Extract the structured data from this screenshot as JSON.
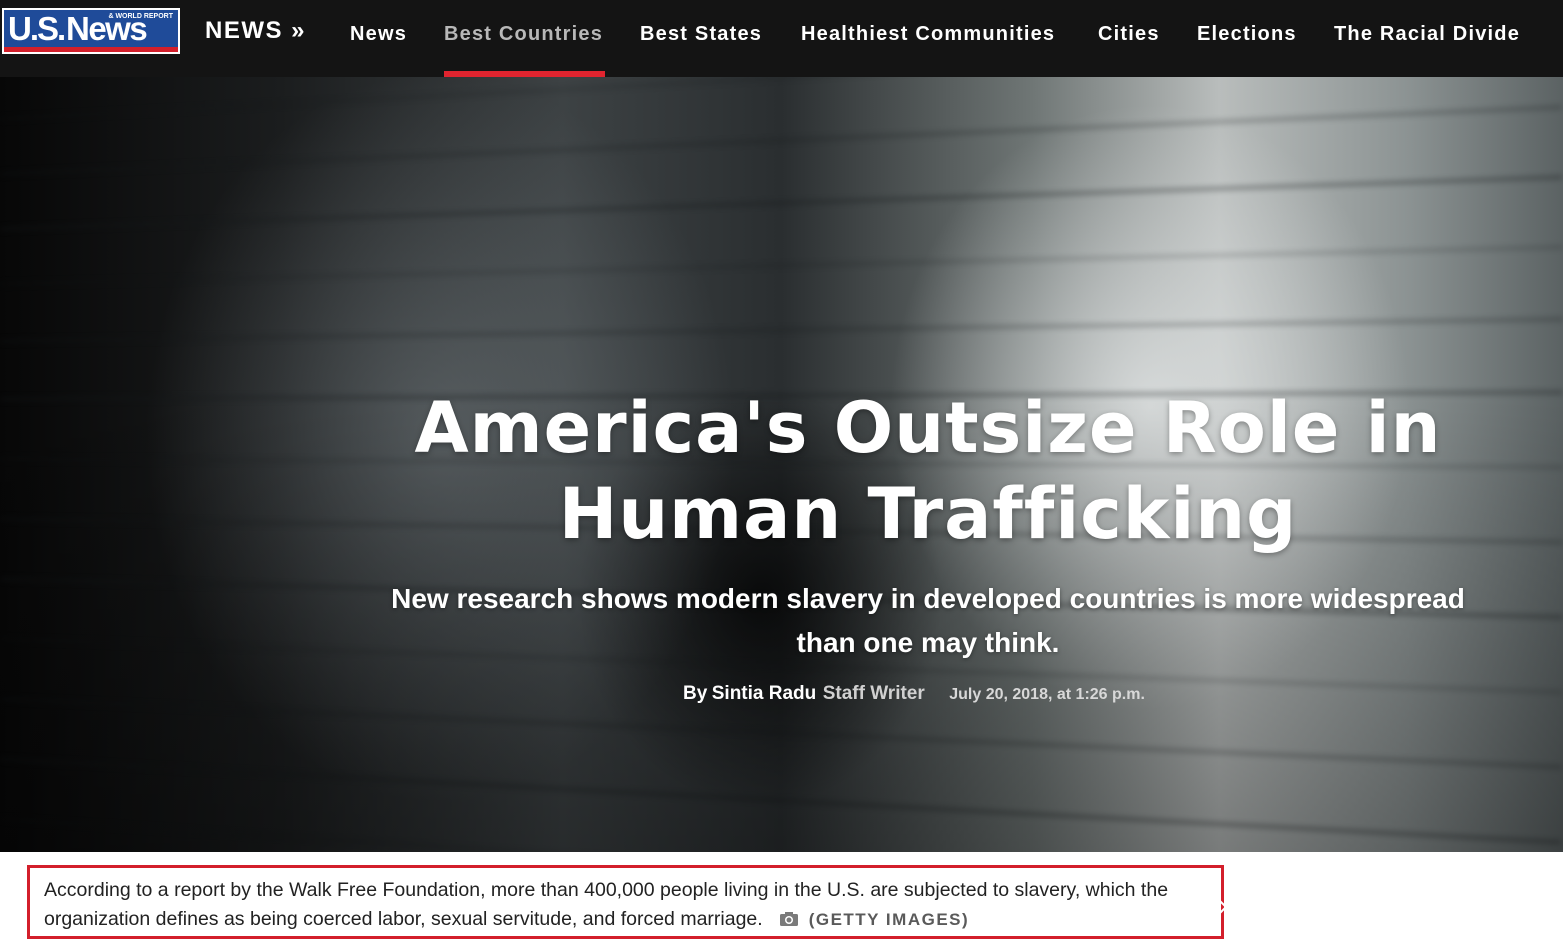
{
  "header": {
    "logo": {
      "main_us": "U.S.",
      "main_news": "News",
      "tagline": "& WORLD REPORT"
    },
    "section_home": "NEWS »",
    "nav_items": [
      {
        "label": "News",
        "active": false
      },
      {
        "label": "Best Countries",
        "active": true
      },
      {
        "label": "Best States",
        "active": false
      },
      {
        "label": "Healthiest Communities",
        "active": false
      },
      {
        "label": "Cities",
        "active": false
      },
      {
        "label": "Elections",
        "active": false
      },
      {
        "label": "The Racial Divide",
        "active": false
      }
    ],
    "active_color": "#e0242f"
  },
  "article": {
    "title_line1": "America's Outsize Role in",
    "title_line2": "Human Trafficking",
    "subtitle": "New research shows modern slavery in developed countries is more widespread than one may think.",
    "byline_prefix": "By",
    "author": "Sintia Radu",
    "author_role": "Staff Writer",
    "date": "July 20, 2018, at 1:26 p.m."
  },
  "caption": {
    "text": "According to a report by the Walk Free Foundation, more than 400,000 people living in the U.S. are subjected to slavery, which the organization defines as being coerced labor, sexual servitude, and forced marriage.",
    "credit": "(GETTY IMAGES)",
    "credit_icon": "camera-icon",
    "highlight_color": "#d31f2b"
  }
}
